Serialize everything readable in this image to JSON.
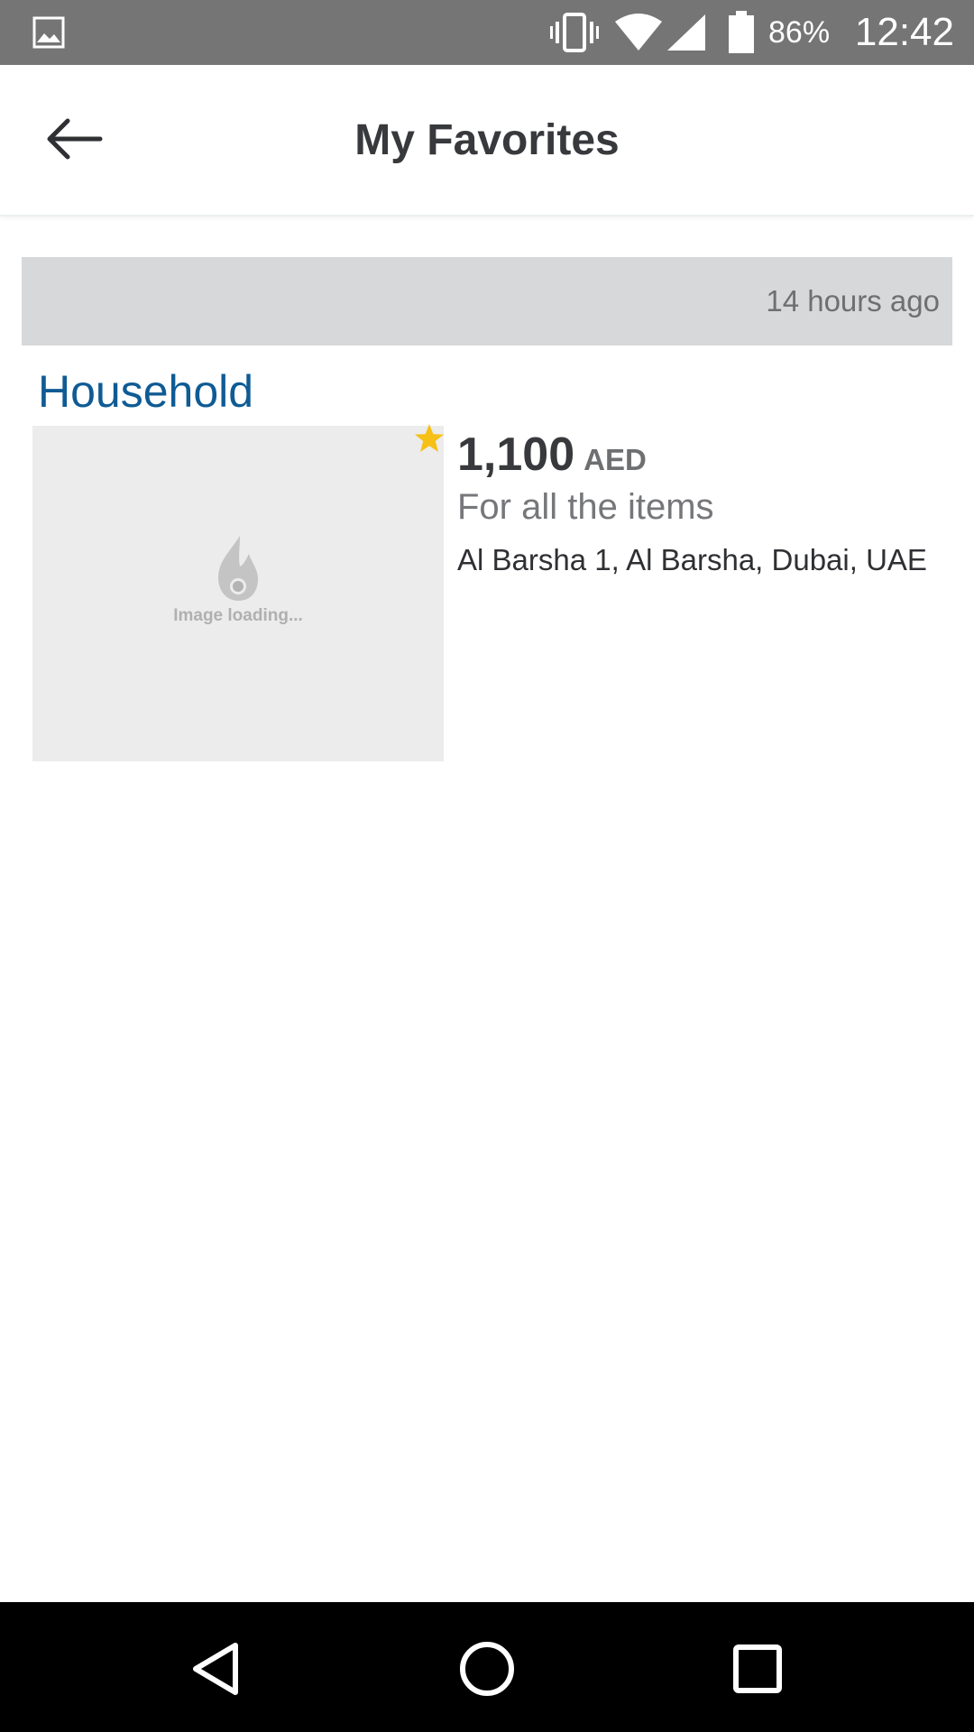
{
  "status_bar": {
    "battery": "86%",
    "time": "12:42"
  },
  "toolbar": {
    "title": "My Favorites"
  },
  "section": {
    "time_ago": "14 hours ago"
  },
  "listing": {
    "category": "Household",
    "image_placeholder": "Image loading...",
    "price": "1,100",
    "currency": "AED",
    "subtitle": "For all the items",
    "location": "Al Barsha 1, Al Barsha, Dubai, UAE"
  },
  "colors": {
    "status_bar": "#757575",
    "category_link": "#0f5b94",
    "star": "#f6c017",
    "header_bg": "#d7d8da"
  },
  "icons": {
    "back": "arrow-left-icon",
    "favorite": "star-icon",
    "nav_back": "triangle-back-icon",
    "nav_home": "circle-home-icon",
    "nav_recents": "square-recents-icon"
  }
}
